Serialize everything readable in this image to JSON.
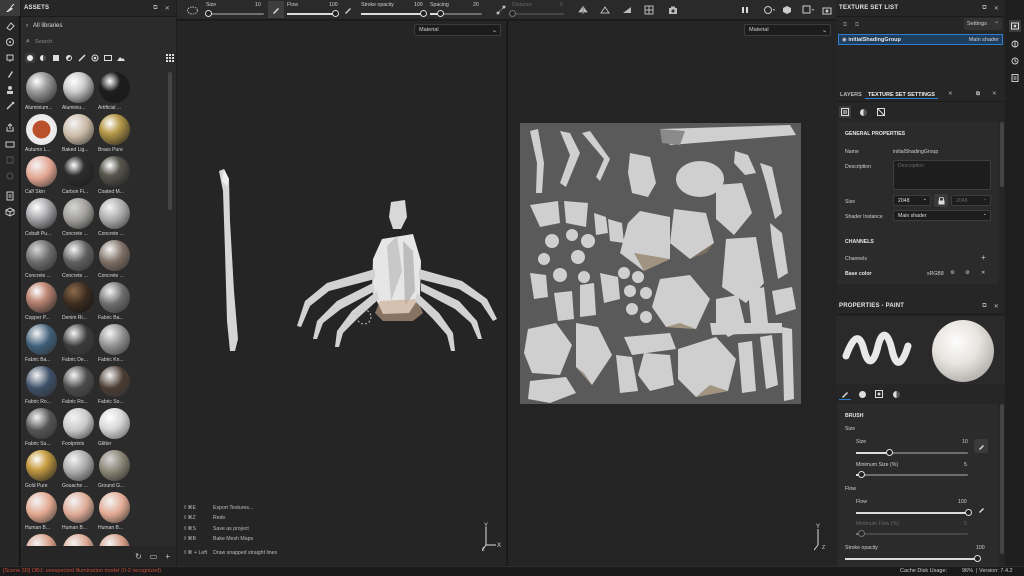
{
  "assets": {
    "title": "ASSETS",
    "library": "All libraries",
    "search_placeholder": "Search",
    "tiles": [
      {
        "label": "Aluminium...",
        "color": "#9d9d9d",
        "style": "glossy"
      },
      {
        "label": "Aluminiu...",
        "color": "#cfcfcf",
        "style": "glossy"
      },
      {
        "label": "Artificial ...",
        "color": "#1c1c1c",
        "style": "glossy"
      },
      {
        "label": "Autumn L...",
        "color": "#b9522c",
        "style": "leaf"
      },
      {
        "label": "Baked Lig...",
        "color": "#c8b8a4",
        "style": "matte"
      },
      {
        "label": "Brass Pure",
        "color": "#b79a4a",
        "style": "glossy"
      },
      {
        "label": "Calf Skin",
        "color": "#e2a48f",
        "style": "matte"
      },
      {
        "label": "Carbon Fi...",
        "color": "#2e2e2e",
        "style": "glossy"
      },
      {
        "label": "Coated M...",
        "color": "#58574e",
        "style": "glossy"
      },
      {
        "label": "Cobalt Pu...",
        "color": "#b4b4b8",
        "style": "glossy"
      },
      {
        "label": "Concrete ...",
        "color": "#9e9d98",
        "style": "rough"
      },
      {
        "label": "Concrete ...",
        "color": "#a8a8a8",
        "style": "matte"
      },
      {
        "label": "Concrete ...",
        "color": "#6a6a6a",
        "style": "rough"
      },
      {
        "label": "Concrete ...",
        "color": "#5e5e5e",
        "style": "matte"
      },
      {
        "label": "Concrete ...",
        "color": "#7c6d62",
        "style": "matte"
      },
      {
        "label": "Copper P...",
        "color": "#c08977",
        "style": "glossy"
      },
      {
        "label": "Denim Ri...",
        "color": "#3a2b20",
        "style": "denim"
      },
      {
        "label": "Fabric Ba...",
        "color": "#6b6b6b",
        "style": "matte"
      },
      {
        "label": "Fabric Ba...",
        "color": "#3e5e78",
        "style": "matte"
      },
      {
        "label": "Fabric De...",
        "color": "#3a3a3a",
        "style": "matte"
      },
      {
        "label": "Fabric Kn...",
        "color": "#8e8e8e",
        "style": "matte"
      },
      {
        "label": "Fabric Ro...",
        "color": "#3b4e66",
        "style": "matte"
      },
      {
        "label": "Fabric Ro...",
        "color": "#4a4a4a",
        "style": "matte"
      },
      {
        "label": "Fabric So...",
        "color": "#4a3c33",
        "style": "matte"
      },
      {
        "label": "Fabric Su...",
        "color": "#545454",
        "style": "matte"
      },
      {
        "label": "Footprints",
        "color": "#c9c9c9",
        "style": "matte"
      },
      {
        "label": "Glitter",
        "color": "#d9d9d9",
        "style": "glitter"
      },
      {
        "label": "Gold Pure",
        "color": "#c99f45",
        "style": "glossy"
      },
      {
        "label": "Gouache ...",
        "color": "#a7a7a7",
        "style": "matte"
      },
      {
        "label": "Ground G...",
        "color": "#868171",
        "style": "rough"
      },
      {
        "label": "Human B...",
        "color": "#e2a78e",
        "style": "matte"
      },
      {
        "label": "Human B...",
        "color": "#deaa95",
        "style": "matte"
      },
      {
        "label": "Human B...",
        "color": "#e2a992",
        "style": "matte"
      },
      {
        "label": "",
        "color": "#d89f88",
        "style": "matte"
      },
      {
        "label": "",
        "color": "#dba690",
        "style": "matte"
      },
      {
        "label": "",
        "color": "#d49a83",
        "style": "matte"
      }
    ]
  },
  "toolbar": {
    "size_label": "Size",
    "size_value": "10",
    "size_fraction": 0.05,
    "flow_label": "Flow",
    "flow_value": "100",
    "flow_fraction": 1.0,
    "opacity_label": "Stroke opacity",
    "opacity_value": "100",
    "opacity_fraction": 1.0,
    "spacing_label": "Spacing",
    "spacing_value": "20",
    "spacing_fraction": 0.2,
    "distance_label": "Distance",
    "distance_value": "0",
    "distance_fraction": 0.0
  },
  "viewport3d": {
    "mode": "Material"
  },
  "viewport2d": {
    "mode": "Material"
  },
  "shortcuts": [
    {
      "keys": "⇧⌘E",
      "action": "Export Textures..."
    },
    {
      "keys": "⇧⌘Z",
      "action": "Redo"
    },
    {
      "keys": "⇧⌘S",
      "action": "Save as project"
    },
    {
      "keys": "⇧⌘B",
      "action": "Bake Mesh Maps"
    },
    {
      "keys": "⇧⌘ + Left",
      "action": "Draw snapped straight lines"
    }
  ],
  "texture_set_list": {
    "title": "TEXTURE SET LIST",
    "settings_label": "Settings",
    "item_name": "initialShadingGroup",
    "item_shader": "Main shader"
  },
  "tabs": {
    "layers": "LAYERS",
    "settings": "TEXTURE SET SETTINGS"
  },
  "tss": {
    "general_title": "GENERAL PROPERTIES",
    "name_label": "Name",
    "name_value": "initialShadingGroup",
    "desc_label": "Description",
    "desc_placeholder": "Description",
    "size_label": "Size",
    "size_value": "2048",
    "size_value2": "2048",
    "shader_label": "Shader Instance",
    "shader_value": "Main shader",
    "channels_title": "CHANNELS",
    "channels_label": "Channels",
    "base_color_label": "Base color",
    "base_color_format": "sRGB8"
  },
  "props": {
    "title": "PROPERTIES - PAINT",
    "brush_title": "BRUSH",
    "size_group": "Size",
    "size_label": "Size",
    "size_value": "10",
    "size_fraction": 0.3,
    "minsize_label": "Minimum Size (%)",
    "minsize_value": "5",
    "minsize_fraction": 0.05,
    "flow_group": "Flow",
    "flow_label": "Flow",
    "flow_value": "100",
    "flow_fraction": 1.0,
    "minflow_label": "Minimum Flow (%)",
    "minflow_value": "5",
    "minflow_fraction": 0.05,
    "opacity_label": "Stroke opacity",
    "opacity_value": "100",
    "opacity_fraction": 1.0
  },
  "status": {
    "error": "[Scene 3D] OBJ: unexpected illumination model (0-2 recognized)",
    "disk_label": "Cache Disk Usage:",
    "disk_value": "96%",
    "version": "| Version: 7.4.2"
  },
  "colors": {
    "accent": "#2f7fd0",
    "error": "#c84b3c"
  }
}
